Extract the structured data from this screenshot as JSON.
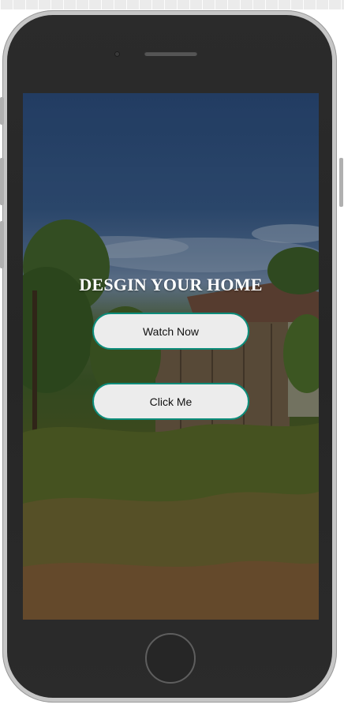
{
  "hero": {
    "title": "DESGIN YOUR HOME"
  },
  "buttons": {
    "watch_now": "Watch Now",
    "click_me": "Click Me"
  },
  "colors": {
    "button_border": "#0b8c7a",
    "button_fill": "#ececec",
    "phone_frame": "#2b2b2b",
    "title_text": "#ffffff"
  },
  "icons": {
    "camera": "front-camera-icon",
    "speaker": "earpiece-speaker-icon",
    "home": "home-button-icon"
  }
}
